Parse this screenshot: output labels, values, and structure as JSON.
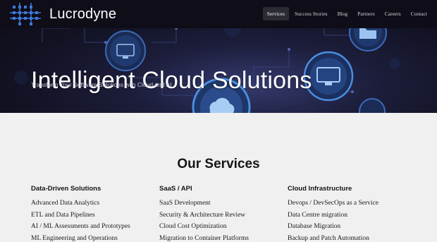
{
  "brand": {
    "name": "Lucrodyne",
    "logo_icon": "circuit-grid-icon"
  },
  "nav": {
    "items": [
      {
        "label": "Services",
        "active": true
      },
      {
        "label": "Success Stories",
        "active": false
      },
      {
        "label": "Blog",
        "active": false
      },
      {
        "label": "Partners",
        "active": false
      },
      {
        "label": "Careers",
        "active": false
      },
      {
        "label": "Contact",
        "active": false
      }
    ]
  },
  "hero": {
    "title": "Intelligent Cloud Solutions",
    "subtitle": "Transform Your Software Solutions with Cloud and AI",
    "icons": [
      "monitor-icon",
      "folder-icon",
      "cloud-icon",
      "desktop-icon",
      "gear-icon"
    ]
  },
  "services": {
    "heading": "Our Services",
    "columns": [
      {
        "title": "Data-Driven Solutions",
        "items": [
          "Advanced Data Analytics",
          "ETL and Data Pipelines",
          "AI / ML Assessments and Prototypes",
          "ML Engineering and Operations"
        ]
      },
      {
        "title": "SaaS / API",
        "items": [
          "SaaS Development",
          "Security & Architecture Review",
          "Cloud Cost Optimization",
          "Migration to Container Platforms"
        ]
      },
      {
        "title": "Cloud Infrastructure",
        "items": [
          "Devops / DevSecOps as a Service",
          "Data Centre migration",
          "Database Migration",
          "Backup and Patch Automation"
        ]
      }
    ]
  },
  "colors": {
    "header_bg": "#0e0d18",
    "hero_bg": "#171830",
    "icon_glow": "#4a8fe0",
    "section_bg": "#f0f0f0"
  }
}
